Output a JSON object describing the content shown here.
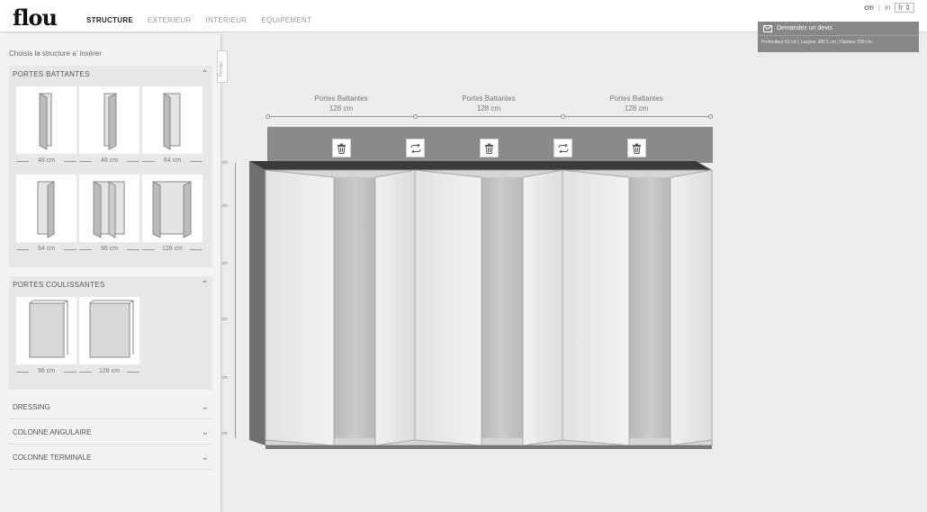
{
  "header": {
    "logo": "flou",
    "nav": [
      "STRUCTURE",
      "EXTERIEUR",
      "INTERIEUR",
      "EQUIPEMENT"
    ],
    "units": {
      "cm": "cm",
      "sep": "|",
      "in": "in",
      "lang": "fr"
    }
  },
  "quote": {
    "button_label": "Demandez un devis",
    "dimensions": "Profondeur 63 cm  |  Largeur 386.5 cm  |  Hauteur 258 cm"
  },
  "sidebar": {
    "intro": "Choisis la structure a' insérer",
    "close_tab": "Fermez",
    "portes_battantes": {
      "title": "PORTES BATTANTES",
      "tiles": [
        "48 cm",
        "48 cm",
        "64 cm",
        "64 cm",
        "96 cm",
        "128 cm"
      ]
    },
    "portes_coulissantes": {
      "title": "PORTES COULISSANTES",
      "tiles": [
        "96 cm",
        "128 cm"
      ]
    },
    "collapsed": [
      "DRESSING",
      "COLONNE ANGULAIRE",
      "COLONNE TERMINALE"
    ]
  },
  "canvas": {
    "modules": [
      {
        "name": "Portes Battantes",
        "width": "128 cm"
      },
      {
        "name": "Portes Battantes",
        "width": "128 cm"
      },
      {
        "name": "Portes Battantes",
        "width": "128 cm"
      }
    ],
    "ruler_ticks": [
      "cm",
      "cm",
      "cm",
      "cm",
      "cm",
      "cm"
    ]
  },
  "colors": {
    "accent": "#878787",
    "topbar": "#8a8a8a",
    "panel": "#f3f3f3"
  }
}
